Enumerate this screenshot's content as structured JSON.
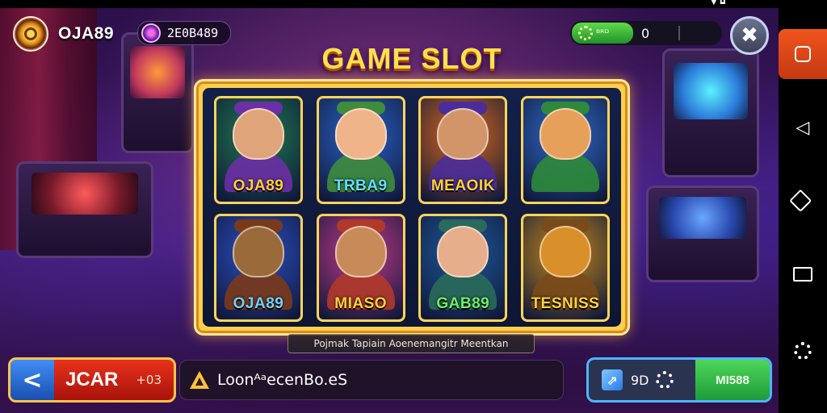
{
  "header": {
    "brand": "OJA89",
    "coin_balance": "2E0B489",
    "wallet_label": "ᴮᴿᴰ",
    "wallet_value": "0",
    "menu_label": "✖"
  },
  "title": "GAME SLOT",
  "tiles": [
    {
      "label": "OJA89",
      "label_color": "#ffd23a",
      "bg": "#1f7a4d",
      "skin": "#e0a47a",
      "outfit": "#6b2fa6"
    },
    {
      "label": "TRBA9",
      "label_color": "#5ee0ff",
      "bg": "#2a63c9",
      "skin": "#f0b48a",
      "outfit": "#3f8c3c"
    },
    {
      "label": "MEAOIK",
      "label_color": "#ffd23a",
      "bg": "#d96a1c",
      "skin": "#d2956a",
      "outfit": "#4a2c9a"
    },
    {
      "label": "",
      "label_color": "#ffd23a",
      "bg": "#2f6ac9",
      "skin": "#e6a05a",
      "outfit": "#2e8a3a"
    },
    {
      "label": "OJA89",
      "label_color": "#6fd2ff",
      "bg": "#2b4fc4",
      "skin": "#9a6a3a",
      "outfit": "#7a3a1a"
    },
    {
      "label": "MIASO",
      "label_color": "#ffd23a",
      "bg": "#c23a8a",
      "skin": "#c98a5a",
      "outfit": "#b03a2a"
    },
    {
      "label": "GAB89",
      "label_color": "#6cf06a",
      "bg": "#1e5a9a",
      "skin": "#e6ae8a",
      "outfit": "#2a6a5a"
    },
    {
      "label": "TESNISS",
      "label_color": "#ffd23a",
      "bg": "#c48a1a",
      "skin": "#d9902a",
      "outfit": "#7a4a1a"
    }
  ],
  "caption": "Pojmak Tapiain Aoenemangitr Meentkan",
  "bottom": {
    "left_label": "JCAR",
    "left_sub": "+03",
    "search_value": "LoonᴬᵃecenBo.eS",
    "right_value": "9D",
    "right_green": "MI588"
  },
  "navbar": {
    "back": "◁",
    "status": "▼ ◘"
  }
}
